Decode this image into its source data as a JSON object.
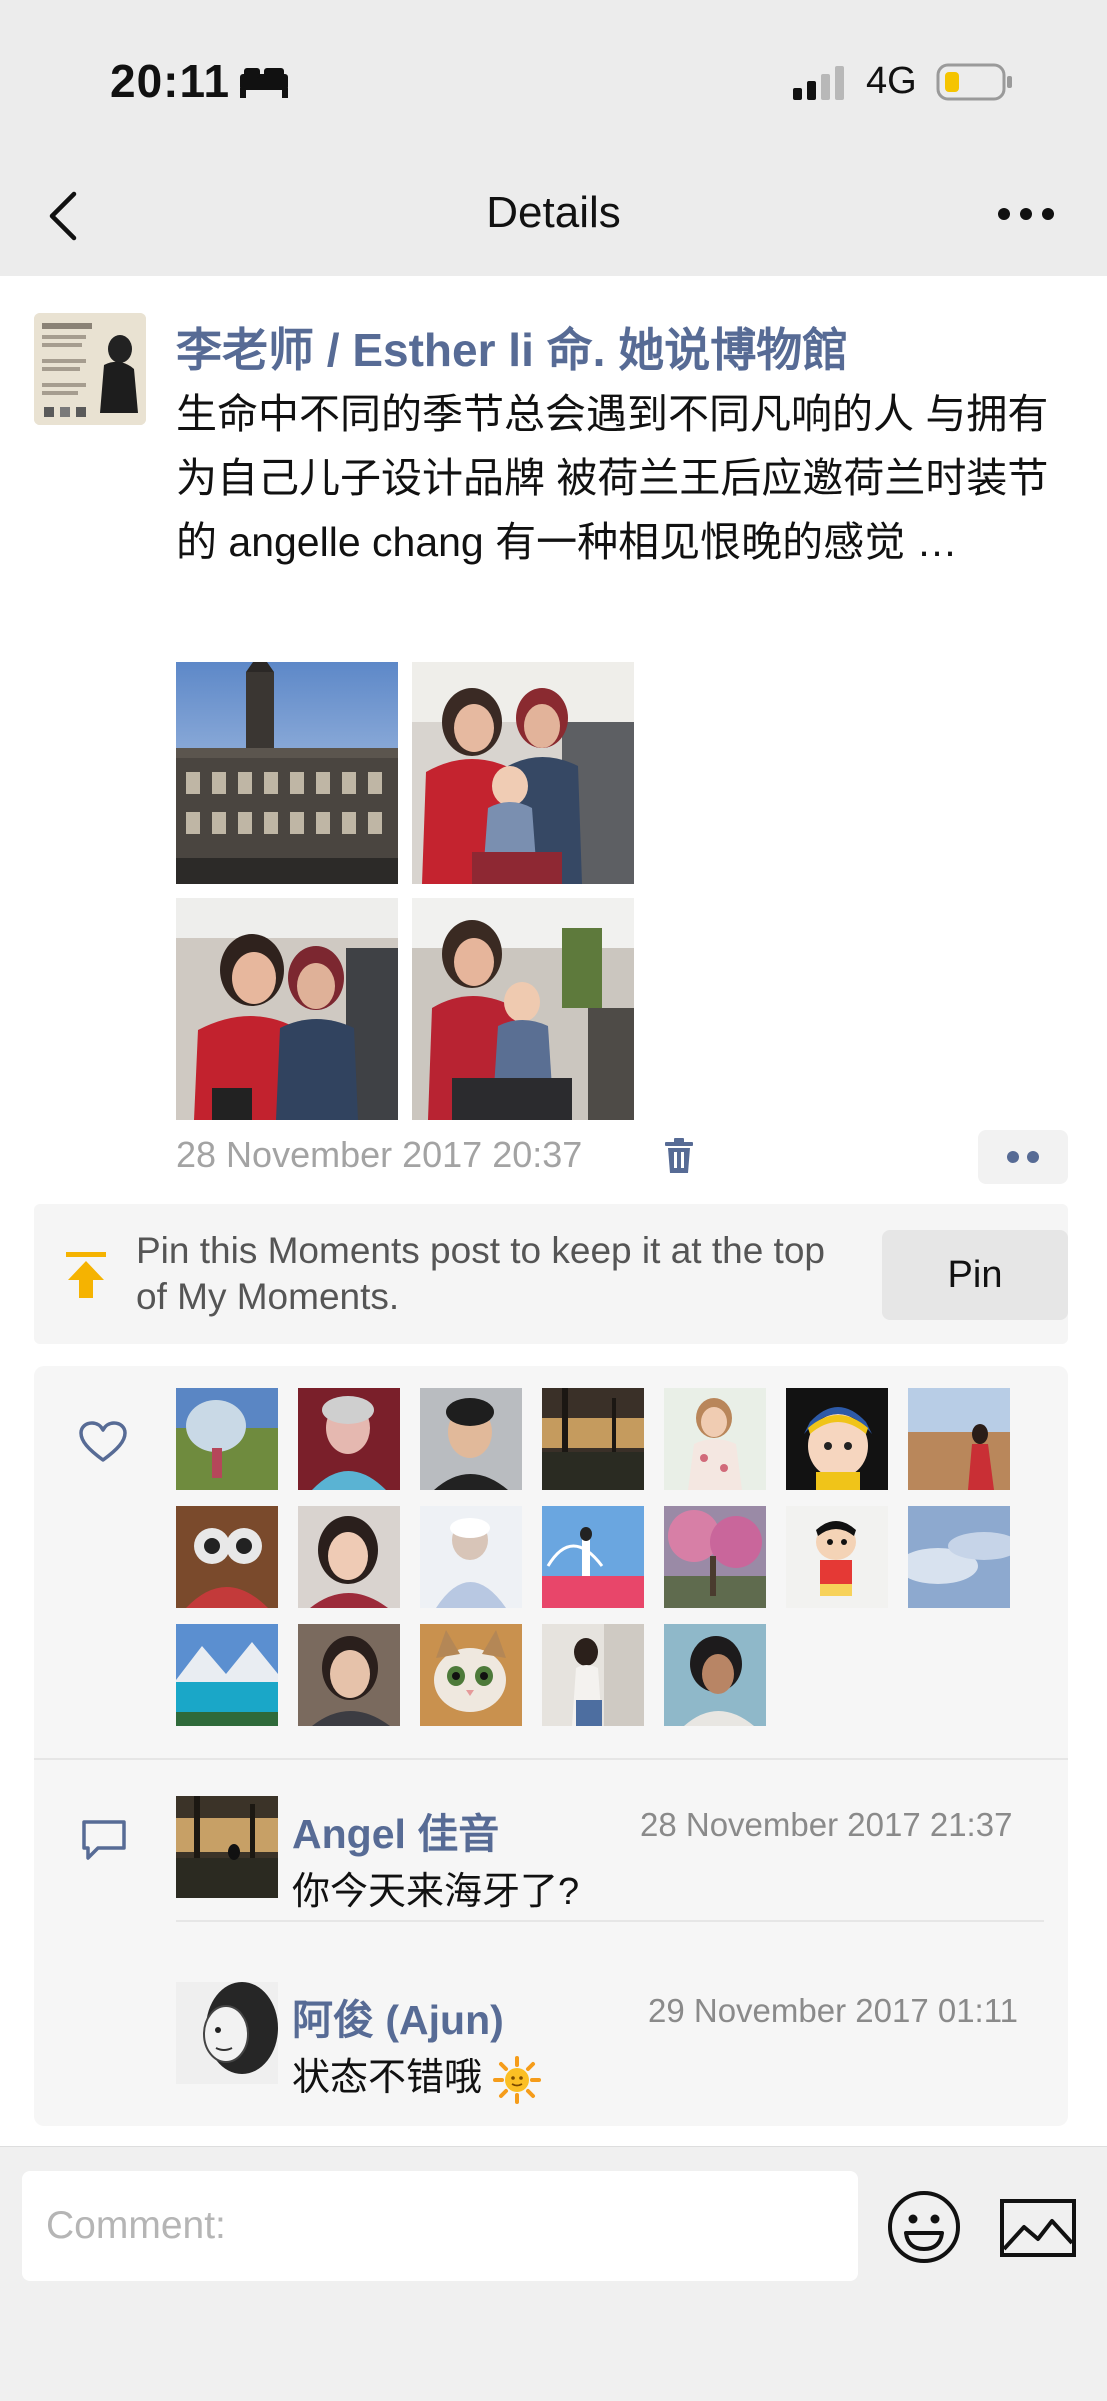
{
  "status": {
    "time": "20:11",
    "network": "4G"
  },
  "nav": {
    "title": "Details"
  },
  "post": {
    "author": "李老师 / Esther li 命. 她说博物館",
    "text": "生命中不同的季节总会遇到不同凡响的人 与拥有为自己儿子设计品牌 被荷兰王后应邀荷兰时装节的 angelle chang 有一种相见恨晚的感觉 …",
    "date": "28 November 2017 20:37"
  },
  "pin": {
    "text": "Pin this Moments post to keep it at the top of My Moments.",
    "button_label": "Pin"
  },
  "comments": [
    {
      "name": "Angel 佳音",
      "time": "28 November 2017 21:37",
      "text": "你今天来海牙了?"
    },
    {
      "name": "阿俊 (Ajun)",
      "time": "29 November 2017 01:11",
      "text": "状态不错哦"
    }
  ],
  "composer": {
    "placeholder": "Comment:"
  },
  "colors": {
    "link": "#576b95",
    "accent": "#f5b301",
    "background": "#f2f2f2"
  }
}
